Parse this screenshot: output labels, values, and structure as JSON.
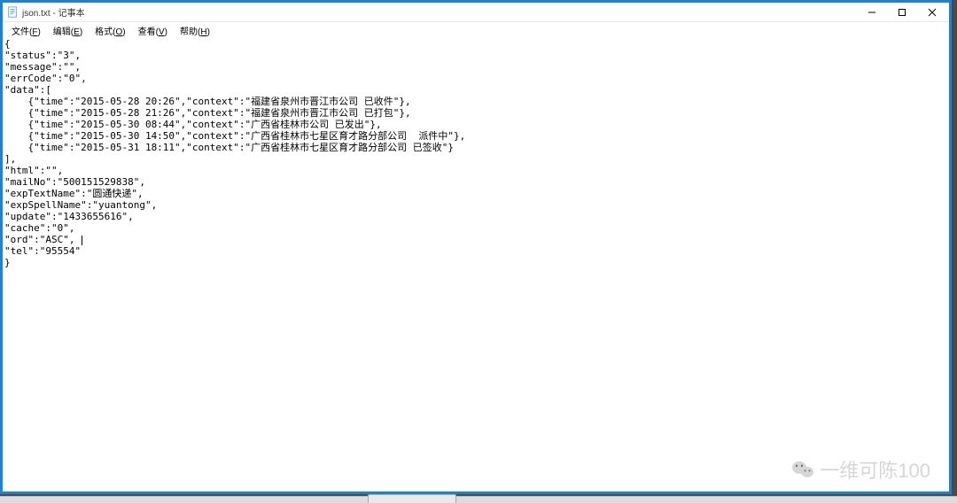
{
  "window": {
    "title": "json.txt - 记事本",
    "menu": {
      "file": "文件(F)",
      "edit": "编辑(E)",
      "format": "格式(O)",
      "view": "查看(V)",
      "help": "帮助(H)"
    }
  },
  "content": {
    "text": "{\n\"status\":\"3\",\n\"message\":\"\",\n\"errCode\":\"0\",\n\"data\":[\n    {\"time\":\"2015-05-28 20:26\",\"context\":\"福建省泉州市晋江市公司 已收件\"},\n    {\"time\":\"2015-05-28 21:26\",\"context\":\"福建省泉州市晋江市公司 已打包\"},\n    {\"time\":\"2015-05-30 08:44\",\"context\":\"广西省桂林市公司 已发出\"},\n    {\"time\":\"2015-05-30 14:50\",\"context\":\"广西省桂林市七星区育才路分部公司  派件中\"},\n    {\"time\":\"2015-05-31 18:11\",\"context\":\"广西省桂林市七星区育才路分部公司 已签收\"}\n],\n\"html\":\"\",\n\"mailNo\":\"500151529838\",\n\"expTextName\":\"圆通快递\",\n\"expSpellName\":\"yuantong\",\n\"update\":\"1433655616\",\n\"cache\":\"0\",\n\"ord\":\"ASC\",\n\"tel\":\"95554\"\n}"
  },
  "json_payload": {
    "status": "3",
    "message": "",
    "errCode": "0",
    "data": [
      {
        "time": "2015-05-28 20:26",
        "context": "福建省泉州市晋江市公司 已收件"
      },
      {
        "time": "2015-05-28 21:26",
        "context": "福建省泉州市晋江市公司 已打包"
      },
      {
        "time": "2015-05-30 08:44",
        "context": "广西省桂林市公司 已发出"
      },
      {
        "time": "2015-05-30 14:50",
        "context": "广西省桂林市七星区育才路分部公司  派件中"
      },
      {
        "time": "2015-05-31 18:11",
        "context": "广西省桂林市七星区育才路分部公司 已签收"
      }
    ],
    "html": "",
    "mailNo": "500151529838",
    "expTextName": "圆通快递",
    "expSpellName": "yuantong",
    "update": "1433655616",
    "cache": "0",
    "ord": "ASC",
    "tel": "95554"
  },
  "watermark": {
    "text": "一维可陈100"
  }
}
